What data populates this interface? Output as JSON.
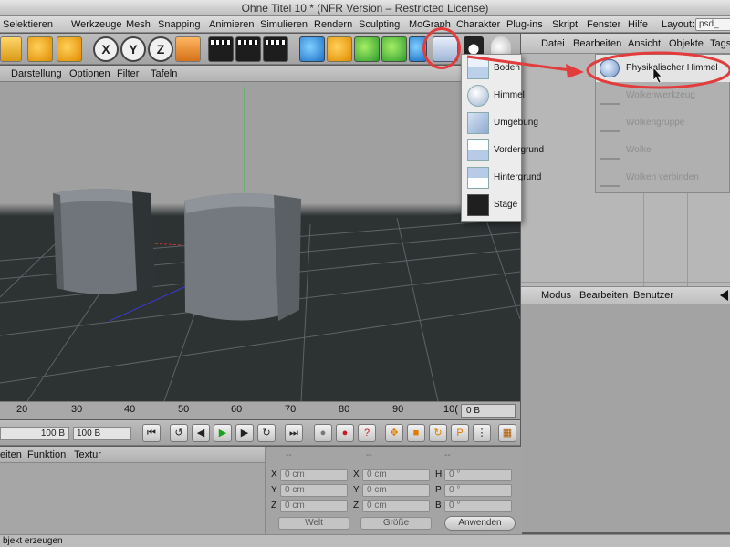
{
  "window": {
    "title": "Ohne Titel 10 * (NFR Version – Restricted License)"
  },
  "menubar": {
    "items": [
      "Selektieren",
      "Werkzeuge",
      "Mesh",
      "Snapping",
      "Animieren",
      "Simulieren",
      "Rendern",
      "Sculpting",
      "MoGraph",
      "Charakter",
      "Plug-ins",
      "Skript",
      "Fenster",
      "Hilfe"
    ],
    "layout_label": "Layout:",
    "layout_value": "psd_"
  },
  "toolbar": {
    "axis_x": "X",
    "axis_y": "Y",
    "axis_z": "Z",
    "icons": [
      "cube-icon",
      "move-icon",
      "rotate-icon",
      "x-axis-lock",
      "y-axis-lock",
      "z-axis-lock",
      "coordinate-system-icon",
      "render-view-icon",
      "render-picture-queue-icon",
      "render-settings-icon",
      "primitive-cube-icon",
      "spline-icon",
      "nurbs-icon",
      "array-icon",
      "deformer-icon",
      "floor-sky-icon",
      "camera-icon",
      "light-icon"
    ]
  },
  "object_manager": {
    "menu": [
      "Datei",
      "Bearbeiten",
      "Ansicht",
      "Objekte",
      "Tags"
    ]
  },
  "attribute_manager": {
    "menu": [
      "Modus",
      "Bearbeiten",
      "Benutzer"
    ]
  },
  "viewport": {
    "menu": [
      "Darstellung",
      "Optionen",
      "Filter",
      "Tafeln"
    ],
    "colors": {
      "sky": "#a0a0a0",
      "floor": "#2d3233",
      "object": "#6f757a"
    }
  },
  "environment_dropdown": {
    "items": [
      {
        "label": "Boden",
        "icon": "floor-icon"
      },
      {
        "label": "Himmel",
        "icon": "sky-sphere-icon"
      },
      {
        "label": "Umgebung",
        "icon": "environment-icon"
      },
      {
        "label": "Vordergrund",
        "icon": "foreground-icon"
      },
      {
        "label": "Hintergrund",
        "icon": "background-icon"
      },
      {
        "label": "Stage",
        "icon": "stage-clapper-icon"
      }
    ]
  },
  "sky_submenu": {
    "items": [
      {
        "label": "Physikalischer Himmel",
        "enabled": true,
        "icon": "physical-sky-icon"
      },
      {
        "label": "Wolkenwerkzeug",
        "enabled": false,
        "icon": "cloud-tool-icon"
      },
      {
        "label": "Wolkengruppe",
        "enabled": false,
        "icon": "cloud-group-icon"
      },
      {
        "label": "Wolke",
        "enabled": false,
        "icon": "cloud-icon"
      },
      {
        "label": "Wolken verbinden",
        "enabled": false,
        "icon": "connect-clouds-icon"
      }
    ]
  },
  "timeline": {
    "ticks": [
      "20",
      "30",
      "40",
      "50",
      "60",
      "70",
      "80",
      "90",
      "10("
    ],
    "current_frame": "0 B"
  },
  "transport": {
    "end_frame_a": "100 B",
    "end_frame_b": "100 B"
  },
  "material_manager": {
    "menu": [
      "eiten",
      "Funktion",
      "Textur"
    ]
  },
  "coordinates": {
    "header": [
      "--",
      "--",
      "--"
    ],
    "rows": [
      {
        "pos_label": "X",
        "pos": "0 cm",
        "size_label": "X",
        "size": "0 cm",
        "rot_label": "H",
        "rot": "0 °"
      },
      {
        "pos_label": "Y",
        "pos": "0 cm",
        "size_label": "Y",
        "size": "0 cm",
        "rot_label": "P",
        "rot": "0 °"
      },
      {
        "pos_label": "Z",
        "pos": "0 cm",
        "size_label": "Z",
        "size": "0 cm",
        "rot_label": "B",
        "rot": "0 °"
      }
    ],
    "mode_select": "Welt",
    "size_select": "Größe",
    "apply_label": "Anwenden"
  },
  "status": {
    "text": "bjekt erzeugen"
  },
  "annotation_color": "#e23c3c"
}
